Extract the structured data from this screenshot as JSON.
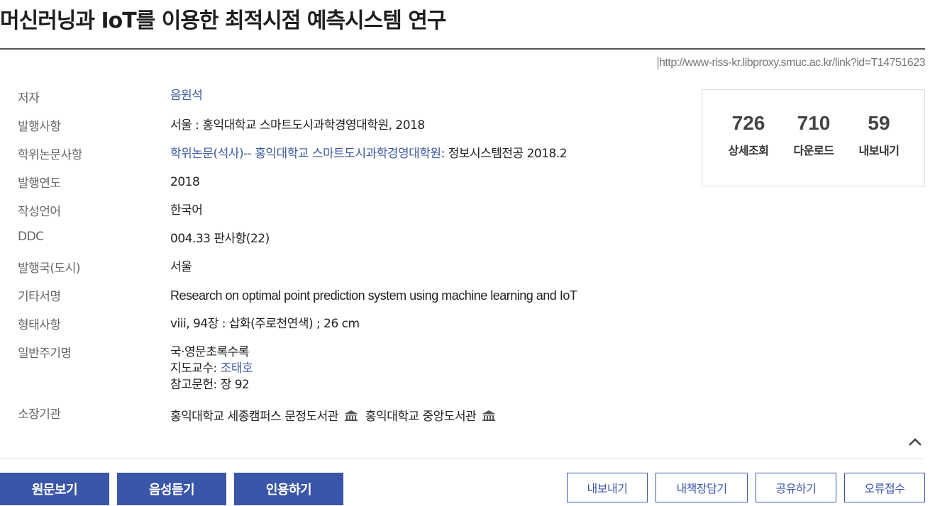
{
  "title": "머신러닝과 IoT를 이용한 최적시점 예측시스템 연구",
  "permalink": "http://www-riss-kr.libproxy.smuc.ac.kr/link?id=T14751623",
  "details": {
    "author": {
      "label": "저자",
      "value": "음원석"
    },
    "publication": {
      "label": "발행사항",
      "value": "서울 : 홍익대학교 스마트도시과학경영대학원, 2018"
    },
    "thesis": {
      "label": "학위논문사항",
      "link": "학위논문(석사)-- 홍익대학교 스마트도시과학경영대학원",
      "rest": ": 정보시스템전공 2018.2"
    },
    "year": {
      "label": "발행연도",
      "value": "2018"
    },
    "language": {
      "label": "작성언어",
      "value": "한국어"
    },
    "ddc": {
      "label": "DDC",
      "value": "004.33 판사항(22)"
    },
    "country": {
      "label": "발행국(도시)",
      "value": "서울"
    },
    "other_title": {
      "label": "기타서명",
      "value": "Research on optimal point prediction system using machine learning and IoT"
    },
    "format": {
      "label": "형태사항",
      "value": "viii, 94장 : 삽화(주로천연색) ; 26 cm"
    },
    "notes": {
      "label": "일반주기명",
      "line1": "국·영문초록수록",
      "advisor_prefix": "지도교수: ",
      "advisor": "조태호",
      "line3": "참고문헌: 장 92"
    },
    "holdings": {
      "label": "소장기관",
      "libraries": [
        "홍익대학교 세종캠퍼스 문정도서관",
        "홍익대학교 중앙도서관"
      ]
    }
  },
  "stats": [
    {
      "value": "726",
      "label": "상세조회"
    },
    {
      "value": "710",
      "label": "다운로드"
    },
    {
      "value": "59",
      "label": "내보내기"
    }
  ],
  "buttons": {
    "view_original": "원문보기",
    "listen": "음성듣기",
    "cite": "인용하기",
    "export": "내보내기",
    "save": "내책장담기",
    "share": "공유하기",
    "report_error": "오류접수"
  },
  "icons": {
    "library": "library-building-icon",
    "collapse": "chevron-up-icon"
  },
  "colors": {
    "accent": "#3a56a8",
    "link": "#3d5a9e"
  }
}
